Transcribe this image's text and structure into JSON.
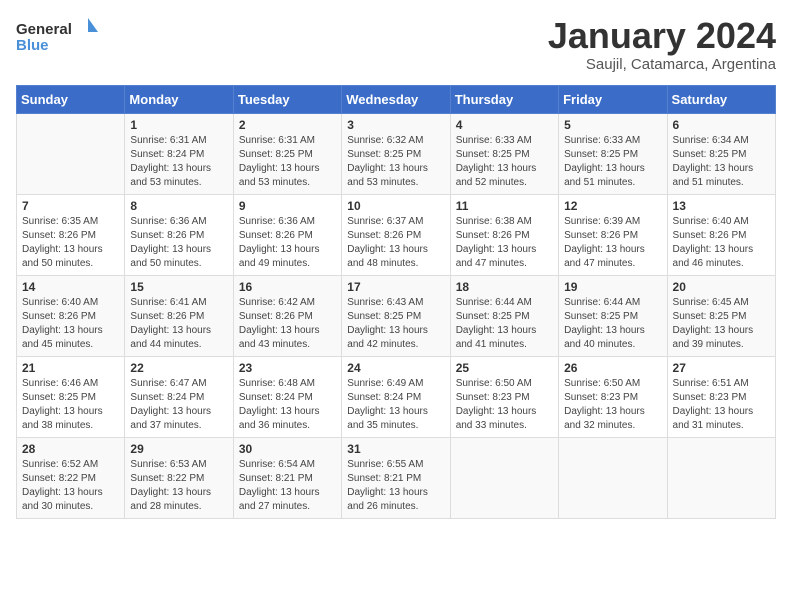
{
  "logo": {
    "general": "General",
    "blue": "Blue"
  },
  "title": "January 2024",
  "subtitle": "Saujil, Catamarca, Argentina",
  "days": [
    "Sunday",
    "Monday",
    "Tuesday",
    "Wednesday",
    "Thursday",
    "Friday",
    "Saturday"
  ],
  "weeks": [
    [
      {
        "day": "",
        "text": ""
      },
      {
        "day": "1",
        "text": "Sunrise: 6:31 AM\nSunset: 8:24 PM\nDaylight: 13 hours\nand 53 minutes."
      },
      {
        "day": "2",
        "text": "Sunrise: 6:31 AM\nSunset: 8:25 PM\nDaylight: 13 hours\nand 53 minutes."
      },
      {
        "day": "3",
        "text": "Sunrise: 6:32 AM\nSunset: 8:25 PM\nDaylight: 13 hours\nand 53 minutes."
      },
      {
        "day": "4",
        "text": "Sunrise: 6:33 AM\nSunset: 8:25 PM\nDaylight: 13 hours\nand 52 minutes."
      },
      {
        "day": "5",
        "text": "Sunrise: 6:33 AM\nSunset: 8:25 PM\nDaylight: 13 hours\nand 51 minutes."
      },
      {
        "day": "6",
        "text": "Sunrise: 6:34 AM\nSunset: 8:25 PM\nDaylight: 13 hours\nand 51 minutes."
      }
    ],
    [
      {
        "day": "7",
        "text": "Sunrise: 6:35 AM\nSunset: 8:26 PM\nDaylight: 13 hours\nand 50 minutes."
      },
      {
        "day": "8",
        "text": "Sunrise: 6:36 AM\nSunset: 8:26 PM\nDaylight: 13 hours\nand 50 minutes."
      },
      {
        "day": "9",
        "text": "Sunrise: 6:36 AM\nSunset: 8:26 PM\nDaylight: 13 hours\nand 49 minutes."
      },
      {
        "day": "10",
        "text": "Sunrise: 6:37 AM\nSunset: 8:26 PM\nDaylight: 13 hours\nand 48 minutes."
      },
      {
        "day": "11",
        "text": "Sunrise: 6:38 AM\nSunset: 8:26 PM\nDaylight: 13 hours\nand 47 minutes."
      },
      {
        "day": "12",
        "text": "Sunrise: 6:39 AM\nSunset: 8:26 PM\nDaylight: 13 hours\nand 47 minutes."
      },
      {
        "day": "13",
        "text": "Sunrise: 6:40 AM\nSunset: 8:26 PM\nDaylight: 13 hours\nand 46 minutes."
      }
    ],
    [
      {
        "day": "14",
        "text": "Sunrise: 6:40 AM\nSunset: 8:26 PM\nDaylight: 13 hours\nand 45 minutes."
      },
      {
        "day": "15",
        "text": "Sunrise: 6:41 AM\nSunset: 8:26 PM\nDaylight: 13 hours\nand 44 minutes."
      },
      {
        "day": "16",
        "text": "Sunrise: 6:42 AM\nSunset: 8:26 PM\nDaylight: 13 hours\nand 43 minutes."
      },
      {
        "day": "17",
        "text": "Sunrise: 6:43 AM\nSunset: 8:25 PM\nDaylight: 13 hours\nand 42 minutes."
      },
      {
        "day": "18",
        "text": "Sunrise: 6:44 AM\nSunset: 8:25 PM\nDaylight: 13 hours\nand 41 minutes."
      },
      {
        "day": "19",
        "text": "Sunrise: 6:44 AM\nSunset: 8:25 PM\nDaylight: 13 hours\nand 40 minutes."
      },
      {
        "day": "20",
        "text": "Sunrise: 6:45 AM\nSunset: 8:25 PM\nDaylight: 13 hours\nand 39 minutes."
      }
    ],
    [
      {
        "day": "21",
        "text": "Sunrise: 6:46 AM\nSunset: 8:25 PM\nDaylight: 13 hours\nand 38 minutes."
      },
      {
        "day": "22",
        "text": "Sunrise: 6:47 AM\nSunset: 8:24 PM\nDaylight: 13 hours\nand 37 minutes."
      },
      {
        "day": "23",
        "text": "Sunrise: 6:48 AM\nSunset: 8:24 PM\nDaylight: 13 hours\nand 36 minutes."
      },
      {
        "day": "24",
        "text": "Sunrise: 6:49 AM\nSunset: 8:24 PM\nDaylight: 13 hours\nand 35 minutes."
      },
      {
        "day": "25",
        "text": "Sunrise: 6:50 AM\nSunset: 8:23 PM\nDaylight: 13 hours\nand 33 minutes."
      },
      {
        "day": "26",
        "text": "Sunrise: 6:50 AM\nSunset: 8:23 PM\nDaylight: 13 hours\nand 32 minutes."
      },
      {
        "day": "27",
        "text": "Sunrise: 6:51 AM\nSunset: 8:23 PM\nDaylight: 13 hours\nand 31 minutes."
      }
    ],
    [
      {
        "day": "28",
        "text": "Sunrise: 6:52 AM\nSunset: 8:22 PM\nDaylight: 13 hours\nand 30 minutes."
      },
      {
        "day": "29",
        "text": "Sunrise: 6:53 AM\nSunset: 8:22 PM\nDaylight: 13 hours\nand 28 minutes."
      },
      {
        "day": "30",
        "text": "Sunrise: 6:54 AM\nSunset: 8:21 PM\nDaylight: 13 hours\nand 27 minutes."
      },
      {
        "day": "31",
        "text": "Sunrise: 6:55 AM\nSunset: 8:21 PM\nDaylight: 13 hours\nand 26 minutes."
      },
      {
        "day": "",
        "text": ""
      },
      {
        "day": "",
        "text": ""
      },
      {
        "day": "",
        "text": ""
      }
    ]
  ]
}
